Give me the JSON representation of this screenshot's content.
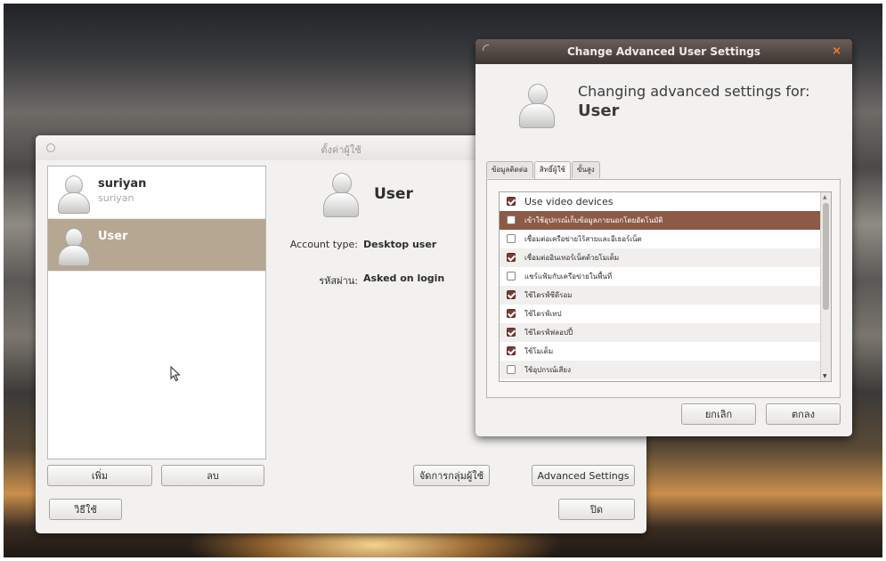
{
  "main_window": {
    "title": "ตั้งค่าผู้ใช้",
    "users": [
      {
        "name": "suriyan",
        "sub": "suriyan"
      },
      {
        "name": "User",
        "sub": ""
      }
    ],
    "selected_user": "User",
    "account_type_label": "Account type:",
    "account_type_value": "Desktop user",
    "password_label": "รหัสผ่าน:",
    "password_value": "Asked on login",
    "buttons": {
      "add": "เพิ่ม",
      "remove": "ลบ",
      "manage_groups": "จัดการกลุ่มผู้ใช้",
      "advanced_settings": "Advanced Settings",
      "help": "วิธีใช้",
      "close": "ปิด"
    }
  },
  "advanced_dialog": {
    "title": "Change Advanced User Settings",
    "close_glyph": "×",
    "heading": "Changing advanced settings for:",
    "user": "User",
    "tabs": [
      "ข้อมูลติดต่อ",
      "สิทธิ์ผู้ใช้",
      "ขั้นสูง"
    ],
    "active_tab": "สิทธิ์ผู้ใช้",
    "privileges": [
      {
        "label": "Use video devices",
        "checked": true
      },
      {
        "label": "เข้าใช้อุปกรณ์เก็บข้อมูลภายนอกโดยอัตโนมัติ",
        "checked": false
      },
      {
        "label": "เชื่อมต่อเครือข่ายไร้สายและอีเธอร์เน็ต",
        "checked": false
      },
      {
        "label": "เชื่อมต่ออินเทอร์เน็ตด้วยโมเด็ม",
        "checked": true
      },
      {
        "label": "แชร์แฟ้มกับเครือข่ายในพื้นที่",
        "checked": false
      },
      {
        "label": "ใช้ไดรฟ์ซีดีรอม",
        "checked": true
      },
      {
        "label": "ใช้ไดรฟ์เทป",
        "checked": true
      },
      {
        "label": "ใช้ไดรฟ์ฟลอปปี้",
        "checked": true
      },
      {
        "label": "ใช้โมเด็ม",
        "checked": true
      },
      {
        "label": "ใช้อุปกรณ์เสียง",
        "checked": false
      }
    ],
    "selected_privilege_index": 1,
    "buttons": {
      "cancel": "ยกเลิก",
      "ok": "ตกลง"
    }
  }
}
